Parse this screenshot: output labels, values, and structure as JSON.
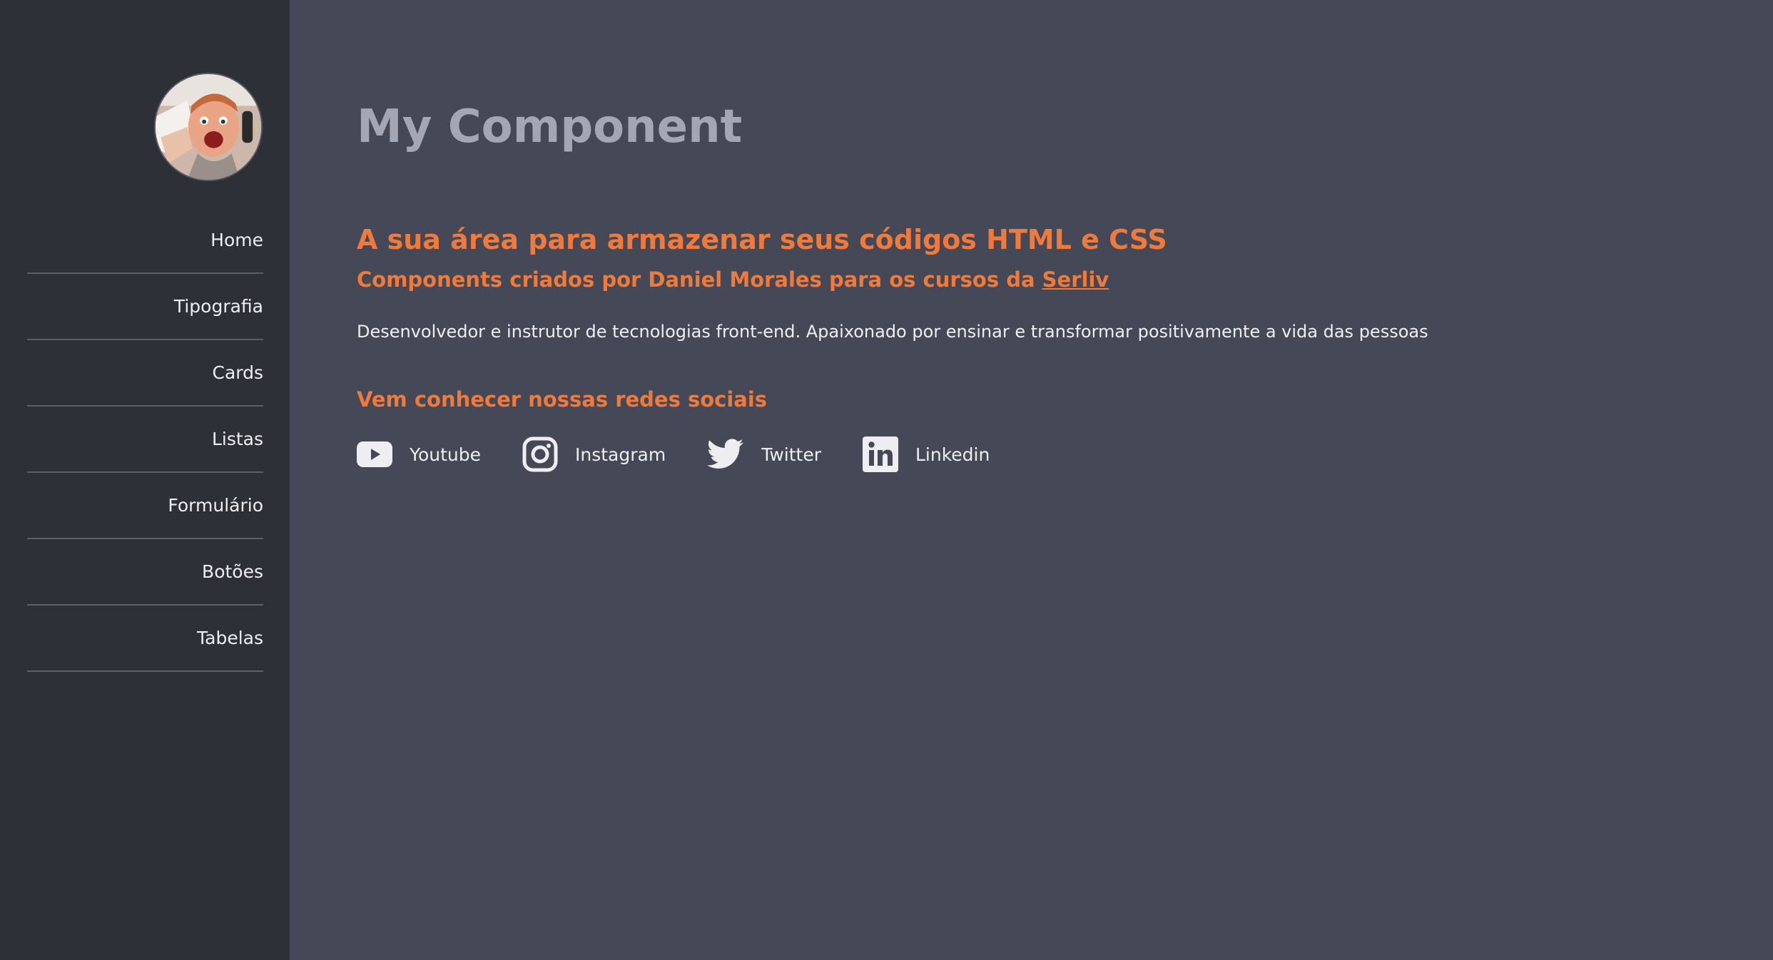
{
  "sidebar": {
    "items": [
      {
        "label": "Home"
      },
      {
        "label": "Tipografia"
      },
      {
        "label": "Cards"
      },
      {
        "label": "Listas"
      },
      {
        "label": "Formulário"
      },
      {
        "label": "Botões"
      },
      {
        "label": "Tabelas"
      }
    ]
  },
  "main": {
    "title": "My Component",
    "headline": "A sua área para armazenar seus códigos HTML e CSS",
    "subheadline_prefix": "Components criados por Daniel Morales para os cursos da ",
    "subheadline_link": "Serliv",
    "description": "Desenvolvedor e instrutor de tecnologias front-end. Apaixonado por ensinar e transformar positivamente a vida das pessoas",
    "social_title": "Vem conhecer nossas redes sociais",
    "social": [
      {
        "label": "Youtube",
        "icon": "youtube-icon"
      },
      {
        "label": "Instagram",
        "icon": "instagram-icon"
      },
      {
        "label": "Twitter",
        "icon": "twitter-icon"
      },
      {
        "label": "Linkedin",
        "icon": "linkedin-icon"
      }
    ]
  },
  "colors": {
    "sidebar_bg": "#2e3038",
    "main_bg": "#454856",
    "accent": "#f07a3c",
    "title": "#a4a7b3",
    "text": "#eeeef2"
  }
}
